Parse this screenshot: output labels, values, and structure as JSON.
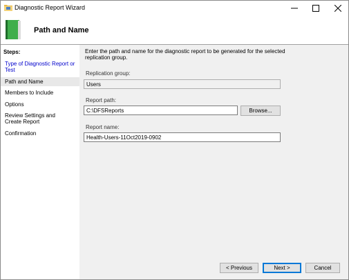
{
  "window": {
    "title": "Diagnostic Report Wizard",
    "controls": {
      "minimize": "—",
      "maximize": "☐",
      "close": "✕"
    }
  },
  "header": {
    "title": "Path and Name"
  },
  "steps": {
    "title": "Steps:",
    "items": [
      {
        "label": "Type of Diagnostic Report or Test",
        "state": "link"
      },
      {
        "label": "Path and Name",
        "state": "current"
      },
      {
        "label": "Members to Include",
        "state": "normal"
      },
      {
        "label": "Options",
        "state": "normal"
      },
      {
        "label": "Review Settings and Create Report",
        "state": "normal"
      },
      {
        "label": "Confirmation",
        "state": "normal"
      }
    ]
  },
  "main": {
    "description": "Enter the path and name for the diagnostic report to be generated for the selected replication group.",
    "replication_group": {
      "label": "Replication group:",
      "value": "Users"
    },
    "report_path": {
      "label": "Report path:",
      "value": "C:\\DFSReports",
      "browse_label": "Browse..."
    },
    "report_name": {
      "label": "Report name:",
      "value": "Health-Users-11Oct2019-0902"
    }
  },
  "footer": {
    "previous_label": "< Previous",
    "next_label": "Next >",
    "cancel_label": "Cancel"
  },
  "colors": {
    "link": "#0000cc",
    "accent": "#0078d7",
    "panel": "#f0f0f0"
  }
}
